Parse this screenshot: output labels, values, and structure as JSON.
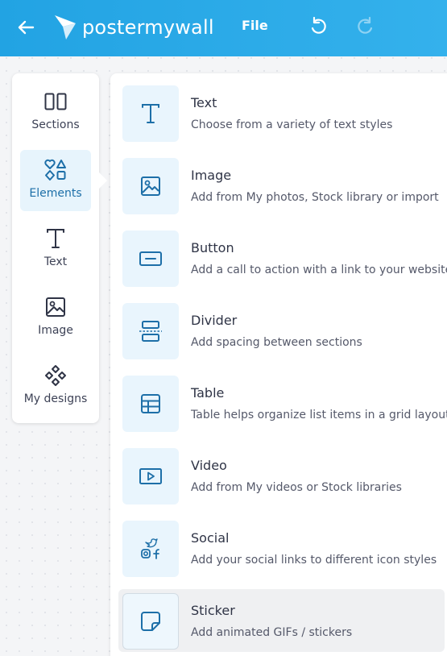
{
  "header": {
    "logo_text": "postermywall",
    "file_label": "File",
    "back_icon": "back-arrow-icon",
    "undo_icon": "undo-icon",
    "redo_icon": "redo-icon"
  },
  "rail": {
    "items": [
      {
        "label": "Sections",
        "icon": "sections-icon",
        "active": false
      },
      {
        "label": "Elements",
        "icon": "elements-icon",
        "active": true
      },
      {
        "label": "Text",
        "icon": "text-icon",
        "active": false
      },
      {
        "label": "Image",
        "icon": "image-icon",
        "active": false
      },
      {
        "label": "My designs",
        "icon": "my-designs-icon",
        "active": false
      }
    ]
  },
  "elements": [
    {
      "title": "Text",
      "description": "Choose from a variety of text styles",
      "icon": "text-icon"
    },
    {
      "title": "Image",
      "description": "Add from My photos, Stock library or import",
      "icon": "image-icon"
    },
    {
      "title": "Button",
      "description": "Add a call to action with a link to your website",
      "icon": "button-icon"
    },
    {
      "title": "Divider",
      "description": "Add spacing between sections",
      "icon": "divider-icon"
    },
    {
      "title": "Table",
      "description": "Table helps organize list items in a grid layout",
      "icon": "table-icon"
    },
    {
      "title": "Video",
      "description": "Add from My videos or Stock libraries",
      "icon": "video-icon"
    },
    {
      "title": "Social",
      "description": "Add your social links to different icon styles",
      "icon": "social-icon"
    },
    {
      "title": "Sticker",
      "description": "Add animated GIFs / stickers",
      "icon": "sticker-icon"
    }
  ],
  "colors": {
    "header_gradient_start": "#22a3e3",
    "header_gradient_end": "#34b1ec",
    "accent": "#1d6fa8",
    "tile_bg": "#e9f5fd",
    "active_bg": "#e7f4fc"
  }
}
